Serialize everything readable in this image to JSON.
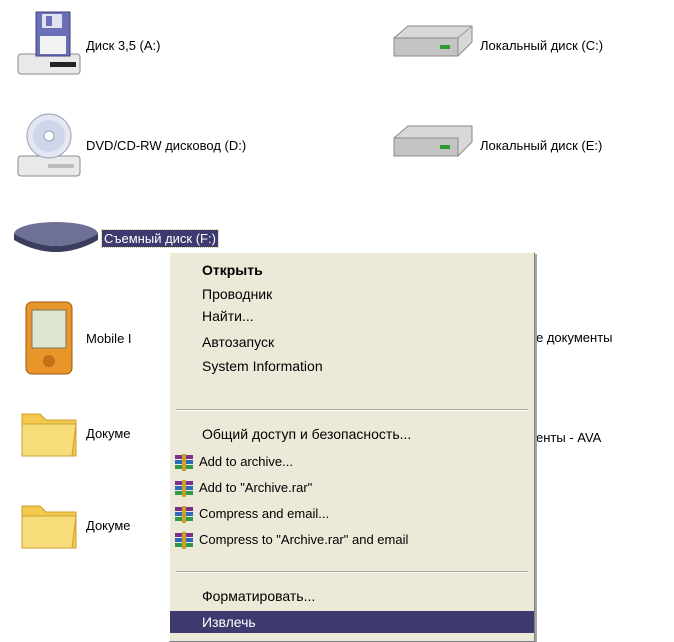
{
  "window": {
    "drives": {
      "floppy_a": "Диск 3,5 (A:)",
      "local_c": "Локальный диск (C:)",
      "dvd_d": "DVD/CD-RW дисковод (D:)",
      "local_e": "Локальный диск (E:)",
      "removable_f": "Съемный диск (F:)"
    },
    "other_items": {
      "mobile": "Mobile I",
      "docs_partial": "е документы",
      "folder1": "Докуме",
      "folder1_right": "енты - AVA",
      "folder2": "Докуме"
    }
  },
  "context_menu": {
    "items": [
      {
        "label": "Открыть"
      },
      {
        "label": "Проводник"
      },
      {
        "label": "Найти..."
      },
      {
        "label": "Автозапуск"
      },
      {
        "label": "System Information"
      },
      {
        "label": "Общий доступ и безопасность..."
      },
      {
        "label": "Add to archive..."
      },
      {
        "label": "Add to \"Archive.rar\""
      },
      {
        "label": "Compress and email..."
      },
      {
        "label": "Compress to \"Archive.rar\" and email"
      },
      {
        "label": "Форматировать..."
      },
      {
        "label": "Извлечь"
      }
    ],
    "highlight_color": "#3c3a6e",
    "background_color": "#ece9d8"
  }
}
